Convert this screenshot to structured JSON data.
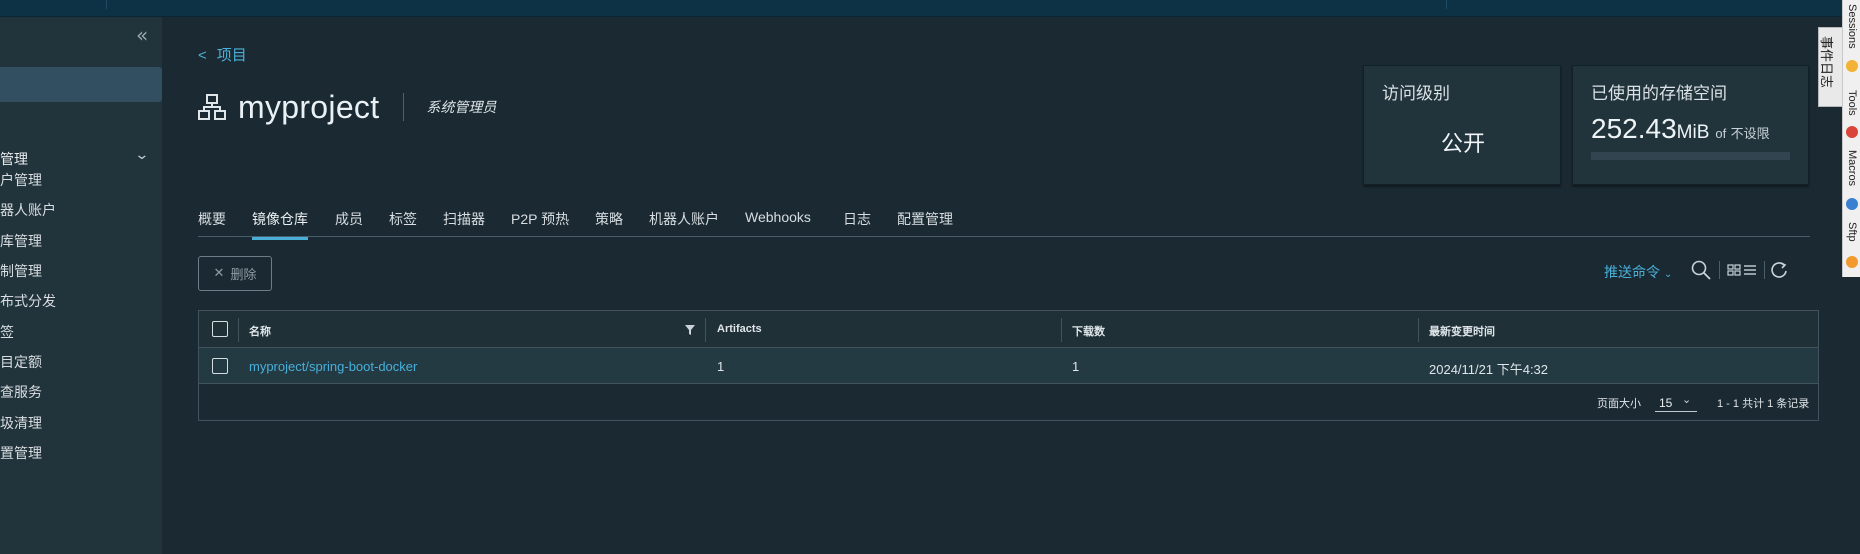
{
  "sidebar": {
    "collapse_icon": "double-chevron-left",
    "group_label": "管理",
    "items": [
      {
        "label": "户管理"
      },
      {
        "label": "器人账户"
      },
      {
        "label": "库管理"
      },
      {
        "label": "制管理"
      },
      {
        "label": "布式分发"
      },
      {
        "label": "签"
      },
      {
        "label": "目定额"
      },
      {
        "label": "查服务"
      },
      {
        "label": "圾清理"
      },
      {
        "label": "置管理"
      }
    ]
  },
  "breadcrumb": {
    "back_symbol": "<",
    "label": "项目"
  },
  "project": {
    "name": "myproject",
    "role": "系统管理员",
    "icon": "project-node-icon"
  },
  "access_card": {
    "title": "访问级别",
    "value": "公开"
  },
  "storage_card": {
    "title": "已使用的存储空间",
    "used_number": "252.43",
    "used_unit": "MiB",
    "of_label": "of",
    "limit": "不设限",
    "used_fraction": 0
  },
  "tabs": [
    {
      "label": "概要"
    },
    {
      "label": "镜像仓库",
      "active": true
    },
    {
      "label": "成员"
    },
    {
      "label": "标签"
    },
    {
      "label": "扫描器"
    },
    {
      "label": "P2P 预热"
    },
    {
      "label": "策略"
    },
    {
      "label": "机器人账户"
    },
    {
      "label": "Webhooks"
    },
    {
      "label": "日志"
    },
    {
      "label": "配置管理"
    }
  ],
  "toolbar": {
    "delete_label": "删除",
    "push_command_label": "推送命令",
    "icons": [
      "search-icon",
      "card-view-icon",
      "list-view-icon",
      "refresh-icon"
    ]
  },
  "table": {
    "columns": [
      "名称",
      "Artifacts",
      "下载数",
      "最新变更时间"
    ],
    "rows": [
      {
        "name": "myproject/spring-boot-docker",
        "artifacts": "1",
        "pulls": "1",
        "updated": "2024/11/21 下午4:32"
      }
    ],
    "footer": {
      "page_size_label": "页面大小",
      "page_size": "15",
      "count_text": "1 - 1 共计 1 条记录"
    }
  },
  "ide_right_bar": {
    "event_log": "事件日志",
    "tools": [
      "Sessions",
      "Tools",
      "Macros",
      "Sftp"
    ]
  },
  "colors": {
    "accent": "#49afd9",
    "background": "#1b2a32",
    "sidebar": "#21333b",
    "topbar": "#0d3145"
  }
}
